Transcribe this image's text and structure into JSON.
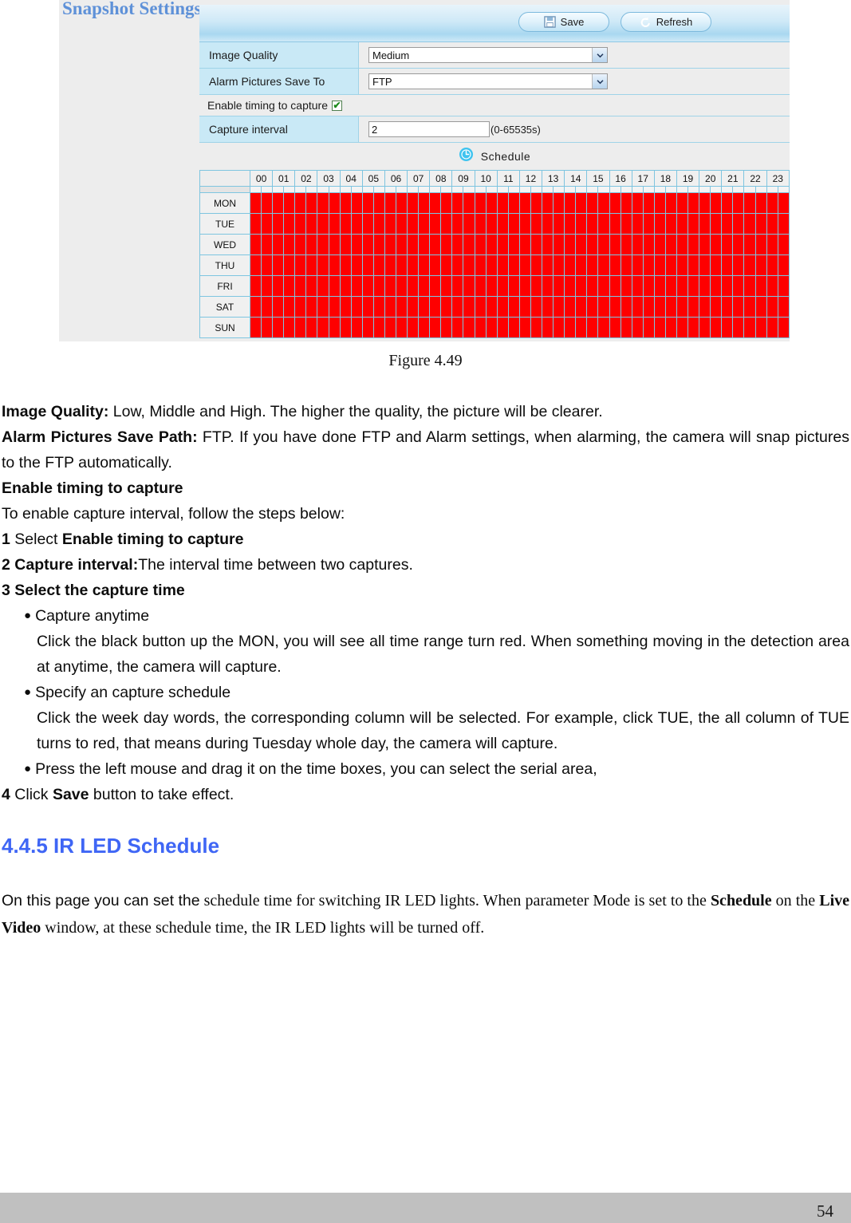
{
  "panel": {
    "title": "Snapshot Settings",
    "toolbar": {
      "save_label": "Save",
      "refresh_label": "Refresh"
    },
    "fields": {
      "image_quality_label": "Image Quality",
      "image_quality_value": "Medium",
      "alarm_pictures_label": "Alarm Pictures Save To",
      "alarm_pictures_value": "FTP",
      "enable_timing_label": "Enable timing to capture",
      "enable_timing_checked": "✔",
      "capture_interval_label": "Capture interval",
      "capture_interval_value": "2",
      "capture_interval_hint": "(0-65535s)",
      "schedule_label": "Schedule"
    },
    "schedule": {
      "hours": [
        "00",
        "01",
        "02",
        "03",
        "04",
        "05",
        "06",
        "07",
        "08",
        "09",
        "10",
        "11",
        "12",
        "13",
        "14",
        "15",
        "16",
        "17",
        "18",
        "19",
        "20",
        "21",
        "22",
        "23"
      ],
      "days": [
        "MON",
        "TUE",
        "WED",
        "THU",
        "FRI",
        "SAT",
        "SUN"
      ],
      "selected_color": "#fe0000",
      "all_selected": true
    }
  },
  "figure": {
    "caption": "Figure 4.49"
  },
  "doc": {
    "image_quality_term": "Image Quality:",
    "image_quality_text": " Low, Middle and High. The higher the quality, the picture will be clearer.",
    "alarm_path_term": "Alarm Pictures Save Path:",
    "alarm_path_text": " FTP. If you have done FTP and Alarm settings, when alarming, the camera will snap pictures to the FTP automatically.",
    "enable_timing_heading": "Enable timing to capture",
    "steps_intro": "To enable capture interval, follow the steps below:",
    "step1_num": "1",
    "step1_text": " Select ",
    "step1_bold": "Enable timing to capture",
    "step2_num": "2 Capture interval:",
    "step2_text": "The interval time between two captures.",
    "step3": "3 Select the capture time",
    "bullet_char": "●",
    "bullet1": "Capture anytime",
    "bullet1_body": "Click the black button up the MON, you will see all time range turn red. When something moving in the detection area at anytime, the camera will capture.",
    "bullet2": "Specify an capture schedule",
    "bullet2_body": "Click the week day words, the corresponding column will be selected. For example, click TUE, the all column of TUE turns to red, that means during Tuesday whole day, the camera will capture.",
    "bullet3": "Press the left mouse and drag it on the time boxes, you can select the serial area,",
    "step4_num": "4",
    "step4_pre": " Click ",
    "step4_bold": "Save",
    "step4_post": " button to take effect.",
    "section_heading": "4.4.5 IR LED Schedule",
    "ir_lead": "On this page you can set the",
    "ir_body_1": " schedule time for switching IR LED lights. When parameter Mode is set to the ",
    "ir_bold_1": "Schedule",
    "ir_body_2": " on the ",
    "ir_bold_2": "Live Video",
    "ir_body_3": " window, at these schedule time, the IR LED lights will be turned off."
  },
  "footer": {
    "page_number": "54"
  }
}
